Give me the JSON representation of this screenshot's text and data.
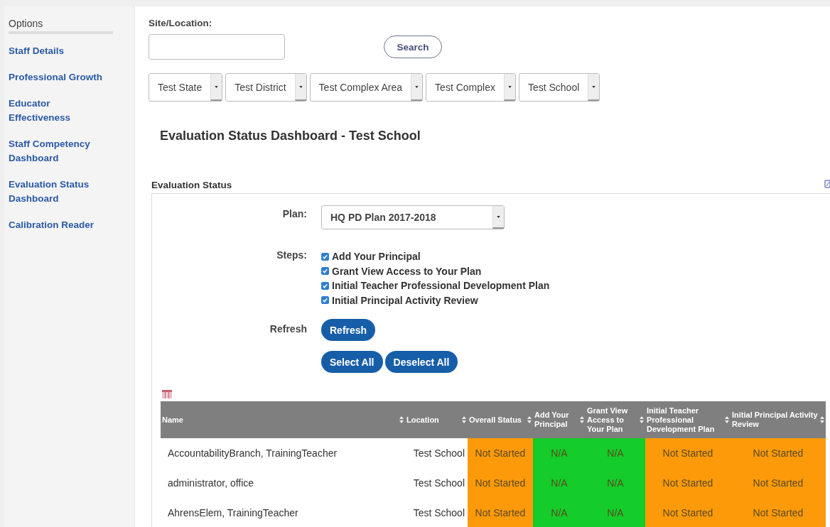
{
  "sidebar": {
    "title": "Options",
    "items": [
      {
        "label": "Staff Details"
      },
      {
        "label": "Professional Growth"
      },
      {
        "label": "Educator Effectiveness"
      },
      {
        "label": "Staff Competency Dashboard"
      },
      {
        "label": "Evaluation Status Dashboard"
      },
      {
        "label": "Calibration Reader"
      }
    ]
  },
  "search": {
    "label": "Site/Location:",
    "button": "Search"
  },
  "filters": [
    {
      "value": "Test State"
    },
    {
      "value": "Test District"
    },
    {
      "value": "Test Complex Area"
    },
    {
      "value": "Test Complex"
    },
    {
      "value": "Test School"
    }
  ],
  "page_title": "Evaluation Status Dashboard - Test School",
  "panel": {
    "title": "Evaluation Status",
    "plan": {
      "label": "Plan:",
      "value": "HQ PD Plan 2017-2018"
    },
    "steps": {
      "label": "Steps:",
      "items": [
        {
          "label": "Add Your Principal",
          "checked": true
        },
        {
          "label": "Grant View Access to Your Plan",
          "checked": true
        },
        {
          "label": "Initial Teacher Professional Development Plan",
          "checked": true
        },
        {
          "label": "Initial Principal Activity Review",
          "checked": true
        }
      ]
    },
    "refresh": {
      "label": "Refresh",
      "button": "Refresh"
    },
    "select_buttons": [
      "Select All",
      "Deselect All"
    ]
  },
  "table": {
    "columns": [
      "Name",
      "Location",
      "Overall Status",
      "Add Your Principal",
      "Grant View Access to Your Plan",
      "Initial Teacher Professional Development Plan",
      "Initial Principal Activity Review"
    ],
    "rows": [
      {
        "name": "AccountabilityBranch, TrainingTeacher",
        "location": "Test School",
        "statuses": [
          {
            "text": "Not Started",
            "color": "#fd9a0a"
          },
          {
            "text": "N/A",
            "color": "#14cc2a"
          },
          {
            "text": "N/A",
            "color": "#14cc2a"
          },
          {
            "text": "Not Started",
            "color": "#fd9a0a"
          },
          {
            "text": "Not Started",
            "color": "#fd9a0a"
          }
        ]
      },
      {
        "name": "administrator, office",
        "location": "Test School",
        "statuses": [
          {
            "text": "Not Started",
            "color": "#fd9a0a"
          },
          {
            "text": "N/A",
            "color": "#14cc2a"
          },
          {
            "text": "N/A",
            "color": "#14cc2a"
          },
          {
            "text": "Not Started",
            "color": "#fd9a0a"
          },
          {
            "text": "Not Started",
            "color": "#fd9a0a"
          }
        ]
      },
      {
        "name": "AhrensElem, TrainingTeacher",
        "location": "Test School",
        "statuses": [
          {
            "text": "Not Started",
            "color": "#fd9a0a"
          },
          {
            "text": "N/A",
            "color": "#14cc2a"
          },
          {
            "text": "N/A",
            "color": "#14cc2a"
          },
          {
            "text": "Not Started",
            "color": "#fd9a0a"
          },
          {
            "text": "Not Started",
            "color": "#fd9a0a"
          }
        ]
      }
    ]
  }
}
